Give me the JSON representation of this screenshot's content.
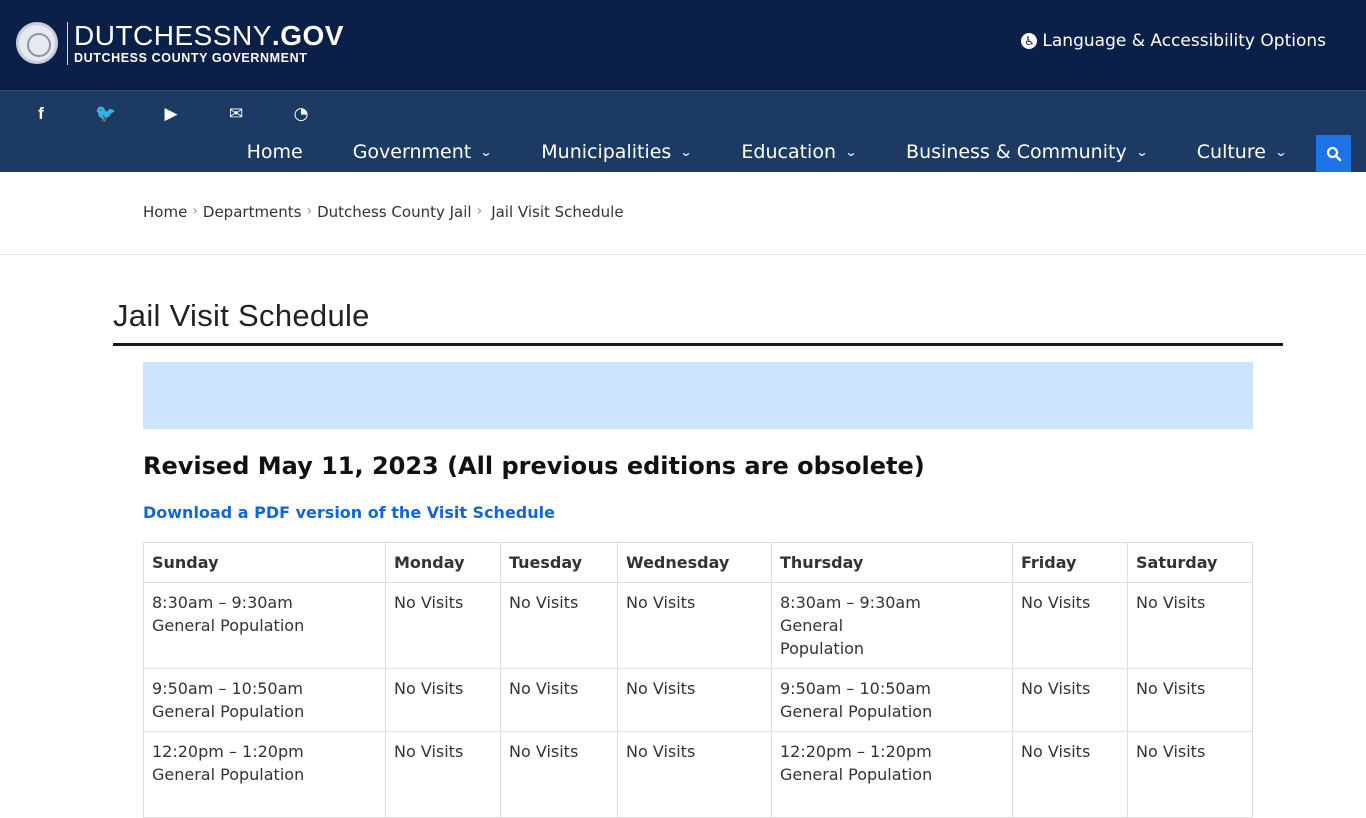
{
  "header": {
    "logo_main": "DUTCHESSNY",
    "logo_tld": ".GOV",
    "logo_sub": "DUTCHESS COUNTY GOVERNMENT",
    "language_options": "Language & Accessibility Options"
  },
  "social_icons": [
    "facebook-icon",
    "twitter-icon",
    "youtube-icon",
    "envelope-icon",
    "rss-icon"
  ],
  "nav": {
    "home": "Home",
    "government": "Government",
    "municipalities": "Municipalities",
    "education": "Education",
    "business": "Business & Community",
    "culture": "Culture"
  },
  "breadcrumb": {
    "home": "Home",
    "departments": "Departments",
    "jail": "Dutchess County Jail",
    "current": "Jail Visit Schedule"
  },
  "page_title": "Jail Visit Schedule",
  "revised": "Revised May 11, 2023 (All previous editions are obsolete)",
  "pdf_link": "Download a PDF version of the Visit Schedule",
  "table": {
    "headers": [
      "Sunday",
      "Monday",
      "Tuesday",
      "Wednesday",
      "Thursday",
      "Friday",
      "Saturday"
    ],
    "rows": [
      [
        {
          "time": "8:30am – 9:30am",
          "type": "General Population"
        },
        {
          "time": "No Visits",
          "type": ""
        },
        {
          "time": "No Visits",
          "type": ""
        },
        {
          "time": "No Visits",
          "type": ""
        },
        {
          "time": "8:30am – 9:30am",
          "type": "General",
          "type2": "Population"
        },
        {
          "time": "No Visits",
          "type": ""
        },
        {
          "time": "No Visits",
          "type": ""
        }
      ],
      [
        {
          "time": "9:50am – 10:50am",
          "type": "General Population"
        },
        {
          "time": "No Visits",
          "type": ""
        },
        {
          "time": "No Visits",
          "type": ""
        },
        {
          "time": "No Visits",
          "type": ""
        },
        {
          "time": "9:50am – 10:50am",
          "type": "General Population"
        },
        {
          "time": "No Visits",
          "type": ""
        },
        {
          "time": "No Visits",
          "type": ""
        }
      ],
      [
        {
          "time": "12:20pm – 1:20pm",
          "type": "General Population"
        },
        {
          "time": "No Visits",
          "type": ""
        },
        {
          "time": "No Visits",
          "type": ""
        },
        {
          "time": "No Visits",
          "type": ""
        },
        {
          "time": "12:20pm – 1:20pm",
          "type": "General Population"
        },
        {
          "time": "No Visits",
          "type": ""
        },
        {
          "time": "No Visits",
          "type": ""
        }
      ]
    ]
  },
  "colors": {
    "top_bar": "#0b2049",
    "nav_bar": "#1c3a63",
    "search_button": "#1e73e8",
    "alert_box": "#cce4ff",
    "link": "#1366d6"
  }
}
